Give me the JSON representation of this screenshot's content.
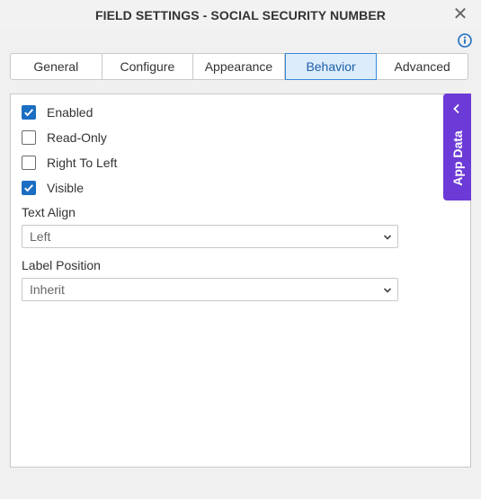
{
  "dialog": {
    "title": "FIELD SETTINGS - SOCIAL SECURITY NUMBER",
    "close_glyph": "✕"
  },
  "icons": {
    "info": "info-icon",
    "close": "close-icon",
    "check": "check-icon",
    "chevron": "chevron-down-icon",
    "appdata_arrow": "chevron-left-icon"
  },
  "colors": {
    "accent": "#1b6ec2",
    "active_tab_bg": "#dcecfb",
    "app_data_bg": "#6c3ad6"
  },
  "tabs": [
    {
      "label": "General",
      "active": false
    },
    {
      "label": "Configure",
      "active": false
    },
    {
      "label": "Appearance",
      "active": false
    },
    {
      "label": "Behavior",
      "active": true
    },
    {
      "label": "Advanced",
      "active": false
    }
  ],
  "behavior": {
    "checkboxes": [
      {
        "label": "Enabled",
        "checked": true
      },
      {
        "label": "Read-Only",
        "checked": false
      },
      {
        "label": "Right To Left",
        "checked": false
      },
      {
        "label": "Visible",
        "checked": true
      }
    ],
    "text_align": {
      "label": "Text Align",
      "value": "Left"
    },
    "label_position": {
      "label": "Label Position",
      "value": "Inherit"
    }
  },
  "app_data": {
    "label": "App Data"
  }
}
